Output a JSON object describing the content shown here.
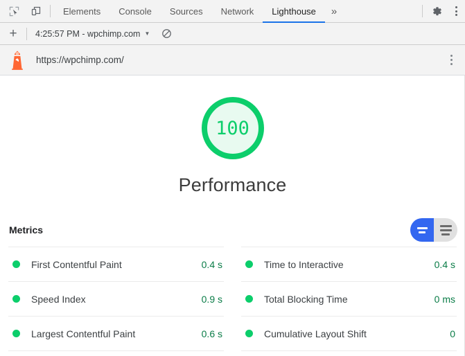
{
  "devtools": {
    "icons": {
      "inspect": "inspect-element-icon",
      "device": "device-toolbar-icon",
      "gear": "settings-gear-icon",
      "kebab": "more-options-icon"
    },
    "tabs": [
      {
        "label": "Elements",
        "active": false
      },
      {
        "label": "Console",
        "active": false
      },
      {
        "label": "Sources",
        "active": false
      },
      {
        "label": "Network",
        "active": false
      },
      {
        "label": "Lighthouse",
        "active": true
      }
    ],
    "more_tabs_label": "»"
  },
  "lighthouse_toolbar": {
    "new_report_label": "+",
    "report_selector": "4:25:57 PM - wpchimp.com",
    "caret": "▼",
    "clear_label": "clear-all-icon"
  },
  "url_bar": {
    "logo": "lighthouse-logo-icon",
    "url": "https://wpchimp.com/",
    "kebab": "report-options-icon"
  },
  "report": {
    "gauge": {
      "score": "100",
      "title": "Performance",
      "stroke_color": "#0CCE6B",
      "fill_color": "#e8faf0",
      "percent": 100
    },
    "metrics": {
      "heading": "Metrics",
      "toggle": {
        "simple_label": "simple-view-icon",
        "expanded_label": "expanded-view-icon",
        "active": "simple",
        "active_color": "#3367f0",
        "inactive_color": "#e0e0e0"
      },
      "columns": [
        [
          {
            "name": "First Contentful Paint",
            "value": "0.4 s",
            "status": "pass"
          },
          {
            "name": "Speed Index",
            "value": "0.9 s",
            "status": "pass"
          },
          {
            "name": "Largest Contentful Paint",
            "value": "0.6 s",
            "status": "pass"
          }
        ],
        [
          {
            "name": "Time to Interactive",
            "value": "0.4 s",
            "status": "pass"
          },
          {
            "name": "Total Blocking Time",
            "value": "0 ms",
            "status": "pass"
          },
          {
            "name": "Cumulative Layout Shift",
            "value": "0",
            "status": "pass"
          }
        ]
      ]
    }
  }
}
